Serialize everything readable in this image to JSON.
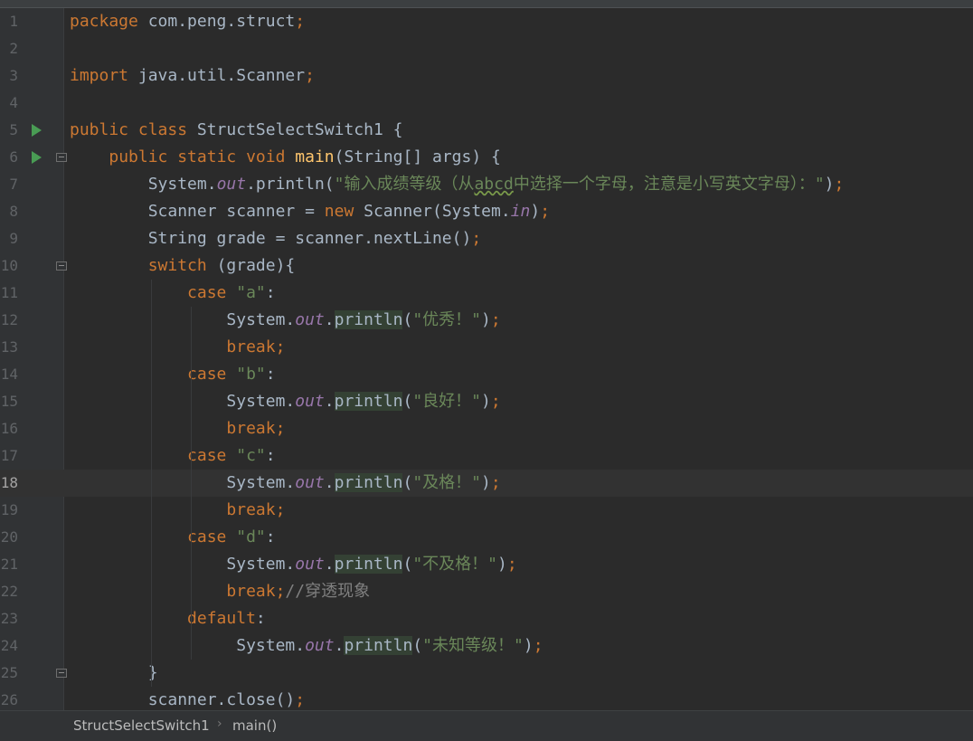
{
  "breadcrumb": {
    "class_name": "StructSelectSwitch1",
    "method_name": "main()"
  },
  "colors": {
    "background": "#2b2b2b",
    "gutter": "#313335",
    "keyword": "#cc7832",
    "string": "#6a8759",
    "field": "#9876aa",
    "method_decl": "#ffc66d",
    "comment": "#808080",
    "text": "#a9b7c6",
    "run_icon": "#499c54"
  },
  "editor": {
    "current_line": 18,
    "lines": [
      {
        "n": "1",
        "tokens": [
          [
            "kw",
            "package"
          ],
          [
            "t",
            " com.peng.struct"
          ],
          [
            "kw",
            ";"
          ]
        ]
      },
      {
        "n": "2",
        "tokens": []
      },
      {
        "n": "3",
        "tokens": [
          [
            "kw",
            "import"
          ],
          [
            "t",
            " java.util.Scanner"
          ],
          [
            "kw",
            ";"
          ]
        ]
      },
      {
        "n": "4",
        "tokens": []
      },
      {
        "n": "5",
        "run": true,
        "tokens": [
          [
            "kw",
            "public class"
          ],
          [
            "t",
            " StructSelectSwitch1 {"
          ]
        ]
      },
      {
        "n": "6",
        "run": true,
        "fold": true,
        "tokens": [
          [
            "t",
            "    "
          ],
          [
            "kw",
            "public static void"
          ],
          [
            "t",
            " "
          ],
          [
            "fn",
            "main"
          ],
          [
            "t",
            "(String[] args) {"
          ]
        ]
      },
      {
        "n": "7",
        "tokens": [
          [
            "t",
            "        System."
          ],
          [
            "fld",
            "out"
          ],
          [
            "t",
            "."
          ],
          [
            "t",
            "println"
          ],
          [
            "t",
            "("
          ],
          [
            "str",
            "\"输入成绩等级（从"
          ],
          [
            "strw",
            "abcd"
          ],
          [
            "str",
            "中选择一个字母，注意是小写英文字母）：\""
          ],
          [
            "t",
            ")"
          ],
          [
            "kw",
            ";"
          ]
        ]
      },
      {
        "n": "8",
        "tokens": [
          [
            "t",
            "        Scanner scanner = "
          ],
          [
            "kw",
            "new"
          ],
          [
            "t",
            " Scanner(System."
          ],
          [
            "fld",
            "in"
          ],
          [
            "t",
            ")"
          ],
          [
            "kw",
            ";"
          ]
        ]
      },
      {
        "n": "9",
        "tokens": [
          [
            "t",
            "        String grade = scanner.nextLine()"
          ],
          [
            "kw",
            ";"
          ]
        ]
      },
      {
        "n": "10",
        "fold": true,
        "tokens": [
          [
            "t",
            "        "
          ],
          [
            "kw",
            "switch"
          ],
          [
            "t",
            " (grade){"
          ]
        ]
      },
      {
        "n": "11",
        "tokens": [
          [
            "t",
            "            "
          ],
          [
            "kw",
            "case"
          ],
          [
            "t",
            " "
          ],
          [
            "str",
            "\"a\""
          ],
          [
            "t",
            ":"
          ]
        ]
      },
      {
        "n": "12",
        "tokens": [
          [
            "t",
            "                System."
          ],
          [
            "fld",
            "out"
          ],
          [
            "t",
            "."
          ],
          [
            "hl",
            "println"
          ],
          [
            "t",
            "("
          ],
          [
            "str",
            "\"优秀！\""
          ],
          [
            "t",
            ")"
          ],
          [
            "kw",
            ";"
          ]
        ]
      },
      {
        "n": "13",
        "tokens": [
          [
            "t",
            "                "
          ],
          [
            "kw",
            "break;"
          ]
        ]
      },
      {
        "n": "14",
        "tokens": [
          [
            "t",
            "            "
          ],
          [
            "kw",
            "case"
          ],
          [
            "t",
            " "
          ],
          [
            "str",
            "\"b\""
          ],
          [
            "t",
            ":"
          ]
        ]
      },
      {
        "n": "15",
        "tokens": [
          [
            "t",
            "                System."
          ],
          [
            "fld",
            "out"
          ],
          [
            "t",
            "."
          ],
          [
            "hl",
            "println"
          ],
          [
            "t",
            "("
          ],
          [
            "str",
            "\"良好！\""
          ],
          [
            "t",
            ")"
          ],
          [
            "kw",
            ";"
          ]
        ]
      },
      {
        "n": "16",
        "tokens": [
          [
            "t",
            "                "
          ],
          [
            "kw",
            "break;"
          ]
        ]
      },
      {
        "n": "17",
        "tokens": [
          [
            "t",
            "            "
          ],
          [
            "kw",
            "case"
          ],
          [
            "t",
            " "
          ],
          [
            "str",
            "\"c\""
          ],
          [
            "t",
            ":"
          ]
        ]
      },
      {
        "n": "18",
        "tokens": [
          [
            "t",
            "                System."
          ],
          [
            "fld",
            "out"
          ],
          [
            "t",
            "."
          ],
          [
            "hl",
            "println"
          ],
          [
            "t",
            "("
          ],
          [
            "str",
            "\"及格！\""
          ],
          [
            "t",
            ")"
          ],
          [
            "kw",
            ";"
          ]
        ]
      },
      {
        "n": "19",
        "tokens": [
          [
            "t",
            "                "
          ],
          [
            "kw",
            "break;"
          ]
        ]
      },
      {
        "n": "20",
        "tokens": [
          [
            "t",
            "            "
          ],
          [
            "kw",
            "case"
          ],
          [
            "t",
            " "
          ],
          [
            "str",
            "\"d\""
          ],
          [
            "t",
            ":"
          ]
        ]
      },
      {
        "n": "21",
        "tokens": [
          [
            "t",
            "                System."
          ],
          [
            "fld",
            "out"
          ],
          [
            "t",
            "."
          ],
          [
            "hl",
            "println"
          ],
          [
            "t",
            "("
          ],
          [
            "str",
            "\"不及格！\""
          ],
          [
            "t",
            ")"
          ],
          [
            "kw",
            ";"
          ]
        ]
      },
      {
        "n": "22",
        "tokens": [
          [
            "t",
            "                "
          ],
          [
            "kw",
            "break;"
          ],
          [
            "cmt",
            "//穿透现象"
          ]
        ]
      },
      {
        "n": "23",
        "tokens": [
          [
            "t",
            "            "
          ],
          [
            "kw",
            "default"
          ],
          [
            "t",
            ":"
          ]
        ]
      },
      {
        "n": "24",
        "tokens": [
          [
            "t",
            "                 System."
          ],
          [
            "fld",
            "out"
          ],
          [
            "t",
            "."
          ],
          [
            "hl",
            "println"
          ],
          [
            "t",
            "("
          ],
          [
            "str",
            "\"未知等级！\""
          ],
          [
            "t",
            ")"
          ],
          [
            "kw",
            ";"
          ]
        ]
      },
      {
        "n": "25",
        "fold": true,
        "tokens": [
          [
            "t",
            "        }"
          ]
        ]
      },
      {
        "n": "26",
        "tokens": [
          [
            "t",
            "        scanner.close()"
          ],
          [
            "kw",
            ";"
          ]
        ]
      }
    ]
  }
}
